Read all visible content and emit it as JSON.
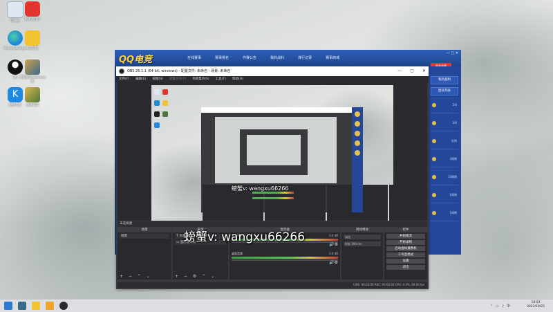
{
  "desktop": {
    "icons": [
      {
        "label": "回收站",
        "color": "#dfe8f0"
      },
      {
        "label": "网易云音乐",
        "color": "#e3342f"
      },
      {
        "label": "Microsoft Edge",
        "color": "#1f8ad6"
      },
      {
        "label": "QQ游戏",
        "color": "#f2c230"
      },
      {
        "label": "QQ",
        "color": "#1d1d1d"
      },
      {
        "label": "英雄联盟WeGame版",
        "color": "#3c6a8c"
      },
      {
        "label": "酷狗音乐",
        "color": "#1e88e5"
      },
      {
        "label": "英雄联盟",
        "color": "#4d7a3a"
      }
    ]
  },
  "qq_window": {
    "logo": "QQ电竞",
    "nav": [
      "在线赛事",
      "赛事报名",
      "作赛公告",
      "我的战利",
      "排行记录",
      "赛事商城"
    ],
    "side_button": "赛季典藏",
    "side_bar": "我的战利",
    "side_bar2": "团队列表",
    "cards": [
      "5/6",
      "3/6",
      "在线",
      "3周期",
      "10周期",
      "1周期",
      "1周期"
    ]
  },
  "obs": {
    "title": "OBS 26.1.1 (64-bit, windows) - 配置文件: 未命名 - 场景: 未命名",
    "menu": [
      "文件(F)",
      "编辑(E)",
      "视图(V)",
      "配置文件(P)",
      "场景集合(S)",
      "工具(T)",
      "帮助(H)"
    ],
    "scene_bar_label": "未选择源",
    "docks": {
      "scenes": {
        "header": "场景",
        "items": [
          "场景"
        ]
      },
      "sources": {
        "header": "来源",
        "items": [
          "文本 (GDI+)",
          "显示器采集"
        ]
      },
      "mixer": {
        "header": "混音器",
        "channels": [
          {
            "name": "麦克风/Aux",
            "db": "0.0 dB"
          },
          {
            "name": "桌面音频",
            "db": "0.0 dB"
          }
        ]
      },
      "transitions": {
        "header": "转场特效",
        "fade": "淡出",
        "duration_label": "时长",
        "duration": "300 ms"
      },
      "controls": {
        "header": "控件",
        "buttons": [
          "开始推流",
          "开始录制",
          "启动虚拟摄像机",
          "工作室模式",
          "设置",
          "退出"
        ]
      }
    },
    "status": "LIVE: 00:00:00    REC: 00:00:00    CPU: 0.0%, 60.00 fps"
  },
  "watermark": "螃蟹v:  wangxu66266",
  "mini_watermark": "螃蟹v: wangxu66266",
  "taskbar": {
    "time": "18:03",
    "date": "2021/10/25",
    "apps": [
      {
        "name": "start",
        "color": "#2a7bd1"
      },
      {
        "name": "league",
        "color": "#3a6a8a"
      },
      {
        "name": "qq-game",
        "color": "#f2c230"
      },
      {
        "name": "folder",
        "color": "#f0a52a"
      },
      {
        "name": "obs",
        "color": "#2b2b30"
      }
    ]
  }
}
